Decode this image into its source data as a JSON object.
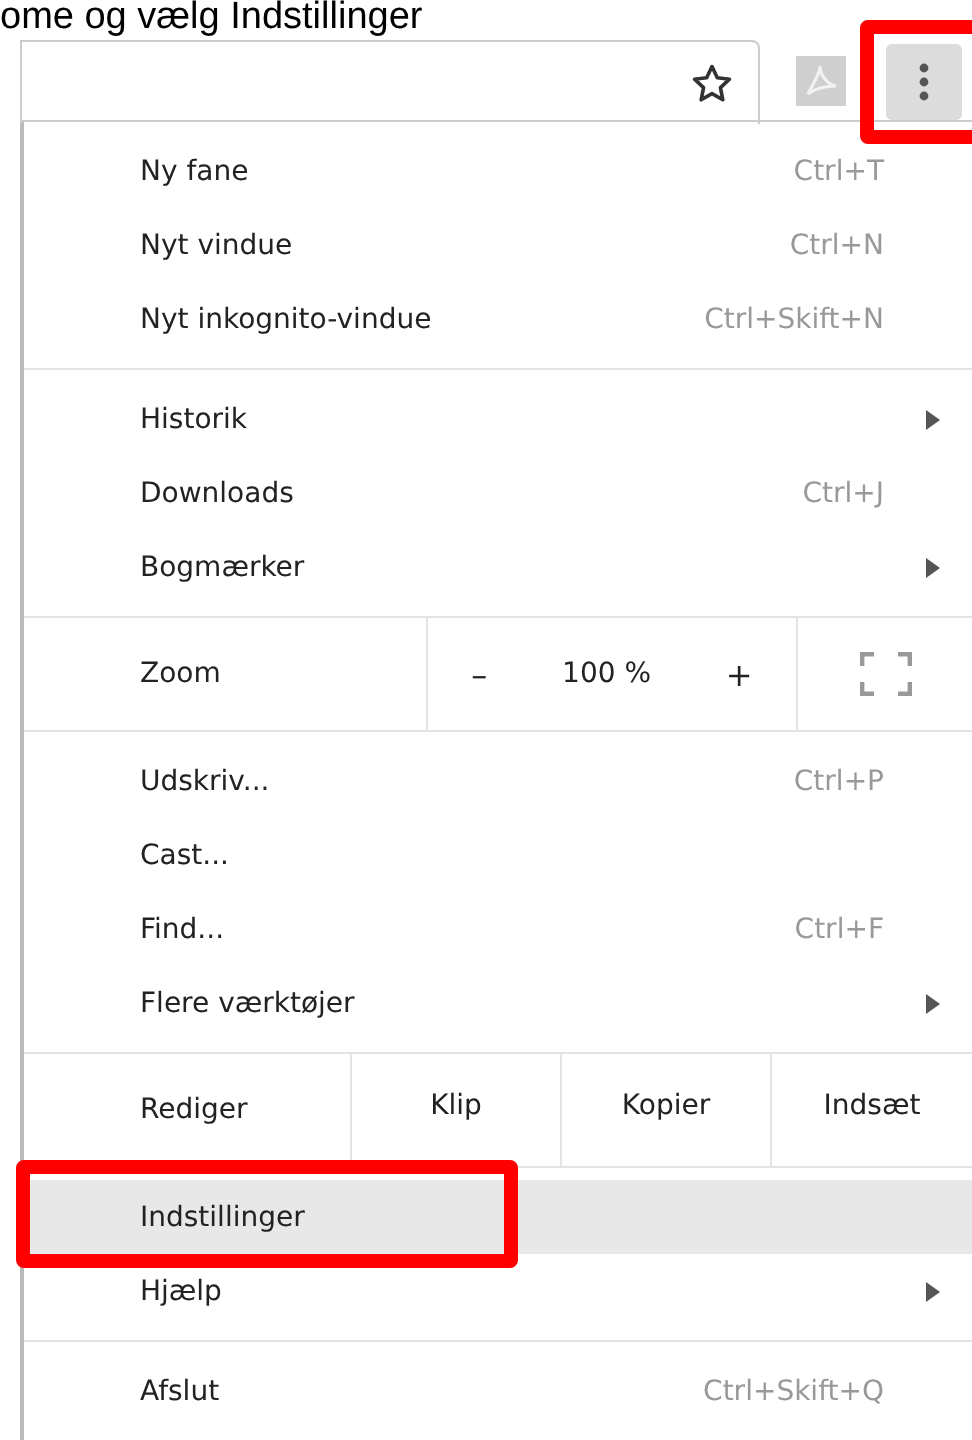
{
  "caption": "ome og vælg Indstillinger",
  "toolbar": {
    "menu_button": {
      "pressed": true,
      "marked": true
    }
  },
  "menu": [
    {
      "kind": "items",
      "items": [
        {
          "label": "Ny fane",
          "shortcut": "Ctrl+T",
          "submenu": false,
          "highlighted": false,
          "marked": false
        },
        {
          "label": "Nyt vindue",
          "shortcut": "Ctrl+N",
          "submenu": false,
          "highlighted": false,
          "marked": false
        },
        {
          "label": "Nyt inkognito-vindue",
          "shortcut": "Ctrl+Skift+N",
          "submenu": false,
          "highlighted": false,
          "marked": false
        }
      ]
    },
    {
      "kind": "items",
      "items": [
        {
          "label": "Historik",
          "submenu": true,
          "highlighted": false,
          "marked": false
        },
        {
          "label": "Downloads",
          "shortcut": "Ctrl+J",
          "submenu": false,
          "highlighted": false,
          "marked": false
        },
        {
          "label": "Bogmærker",
          "submenu": true,
          "highlighted": false,
          "marked": false
        }
      ]
    },
    {
      "kind": "zoom",
      "label": "Zoom",
      "minus": "–",
      "value": "100 %",
      "plus": "+"
    },
    {
      "kind": "items",
      "items": [
        {
          "label": "Udskriv...",
          "shortcut": "Ctrl+P",
          "submenu": false,
          "highlighted": false,
          "marked": false
        },
        {
          "label": "Cast...",
          "submenu": false,
          "highlighted": false,
          "marked": false
        },
        {
          "label": "Find...",
          "shortcut": "Ctrl+F",
          "submenu": false,
          "highlighted": false,
          "marked": false
        },
        {
          "label": "Flere værktøjer",
          "submenu": true,
          "highlighted": false,
          "marked": false
        }
      ]
    },
    {
      "kind": "edit",
      "label": "Rediger",
      "buttons": [
        "Klip",
        "Kopier",
        "Indsæt"
      ]
    },
    {
      "kind": "items",
      "items": [
        {
          "label": "Indstillinger",
          "submenu": false,
          "highlighted": true,
          "marked": true
        },
        {
          "label": "Hjælp",
          "submenu": true,
          "highlighted": false,
          "marked": false
        }
      ]
    },
    {
      "kind": "items",
      "items": [
        {
          "label": "Afslut",
          "shortcut": "Ctrl+Skift+Q",
          "submenu": false,
          "highlighted": false,
          "marked": false
        }
      ]
    }
  ]
}
